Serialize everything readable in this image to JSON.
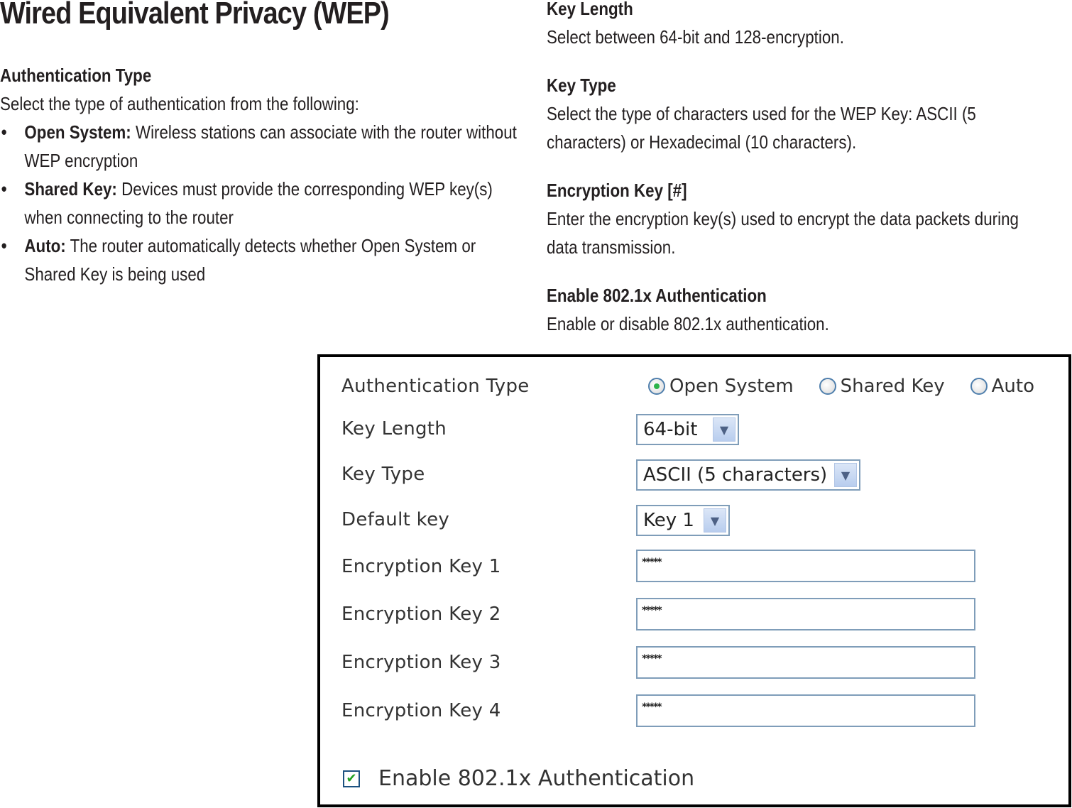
{
  "title": "Wired Equivalent Privacy (WEP)",
  "left": {
    "heading": "Authentication Type",
    "intro": "Select the type of authentication from the following:",
    "bullet_char": "•",
    "bullets": [
      {
        "term": "Open System:",
        "text": " Wireless stations can associate with the router without WEP encryption"
      },
      {
        "term": "Shared Key:",
        "text": " Devices must provide the corresponding WEP key(s) when connecting to the router"
      },
      {
        "term": "Auto:",
        "text": " The router automatically detects whether Open System or Shared Key is being used"
      }
    ]
  },
  "right": {
    "sections": [
      {
        "heading": "Key Length",
        "text": "Select between 64-bit and 128-encryption."
      },
      {
        "heading": "Key Type",
        "text": "Select the type of characters used for the WEP Key: ASCII (5 characters) or Hexadecimal (10 characters)."
      },
      {
        "heading": "Encryption Key [#]",
        "text": "Enter the encryption key(s) used to encrypt the data packets during data transmission."
      },
      {
        "heading": "Enable 802.1x Authentication",
        "text": "Enable or disable 802.1x authentication."
      }
    ]
  },
  "panel": {
    "labels": {
      "auth_type": "Authentication Type",
      "key_length": "Key Length",
      "key_type": "Key Type",
      "default_key": "Default key",
      "enc_key_1": "Encryption Key 1",
      "enc_key_2": "Encryption Key 2",
      "enc_key_3": "Encryption Key 3",
      "enc_key_4": "Encryption Key 4"
    },
    "auth_options": [
      {
        "label": "Open System",
        "checked": true
      },
      {
        "label": "Shared Key",
        "checked": false
      },
      {
        "label": "Auto",
        "checked": false
      }
    ],
    "key_length_value": "64-bit",
    "key_type_value": "ASCII (5 characters)",
    "default_key_value": "Key 1",
    "dropdown_arrow": "▼",
    "enc_keys": [
      "*****",
      "*****",
      "*****",
      "*****"
    ],
    "enable_8021x_label": "Enable 802.1x Authentication",
    "enable_8021x_checked": true,
    "check_glyph": "✔"
  }
}
